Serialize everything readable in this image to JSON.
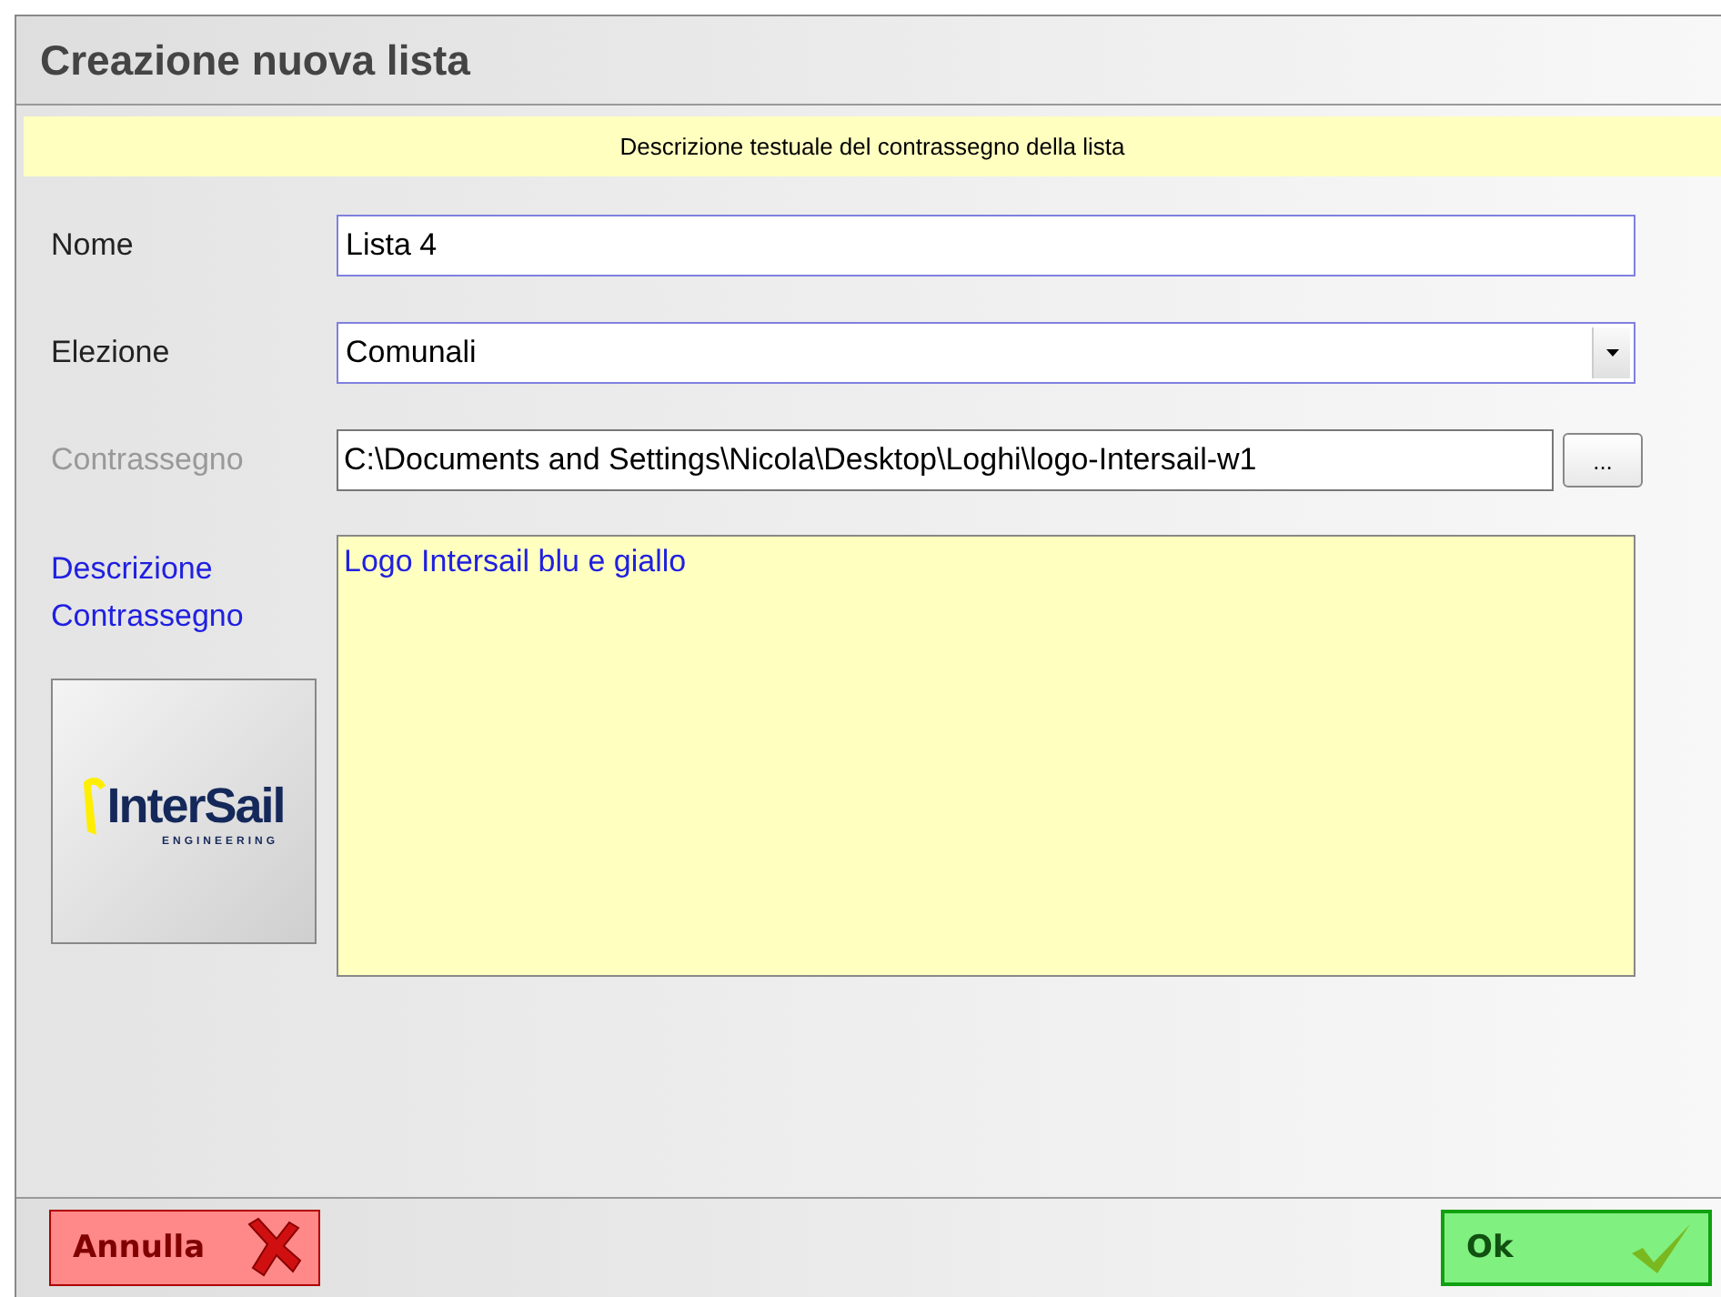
{
  "window": {
    "title": "Creazione nuova lista"
  },
  "banner": "Descrizione testuale del contrassegno della lista",
  "fields": [
    {
      "kind": "text",
      "label": "Nome",
      "value": "Lista 4",
      "disabled": false
    },
    {
      "kind": "select",
      "label": "Elezione",
      "value": "Comunali",
      "disabled": false
    },
    {
      "kind": "file",
      "label": "Contrassegno",
      "value": "C:\\Documents and Settings\\Nicola\\Desktop\\Loghi\\logo-Intersail-w1",
      "browse": "...",
      "disabled": true
    }
  ],
  "description": {
    "label_lines": [
      "Descrizione",
      "Contrassegno"
    ],
    "value": "Logo Intersail blu e giallo"
  },
  "logo": {
    "name": "InterSail",
    "tagline": "ENGINEERING"
  },
  "buttons": [
    {
      "kind": "cancel",
      "label": "Annulla"
    },
    {
      "kind": "ok",
      "label": "Ok"
    }
  ]
}
